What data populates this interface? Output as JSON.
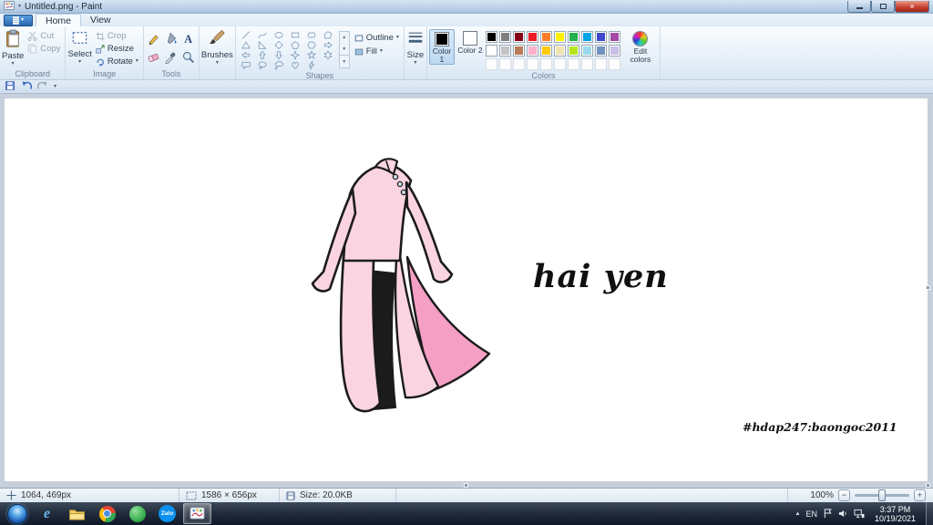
{
  "window": {
    "title": "Untitled.png - Paint"
  },
  "tabs": {
    "home": "Home",
    "view": "View"
  },
  "ribbon": {
    "clipboard": {
      "group_label": "Clipboard",
      "paste_label": "Paste",
      "cut_label": "Cut",
      "copy_label": "Copy"
    },
    "image": {
      "group_label": "Image",
      "select_label": "Select",
      "crop_label": "Crop",
      "resize_label": "Resize",
      "rotate_label": "Rotate"
    },
    "tools": {
      "group_label": "Tools",
      "items": [
        "pencil",
        "fill-with-color",
        "text",
        "eraser",
        "color-picker",
        "magnifier"
      ]
    },
    "brushes": {
      "label": "Brushes"
    },
    "shapes": {
      "group_label": "Shapes",
      "outline_label": "Outline",
      "fill_label": "Fill",
      "items": [
        "line",
        "curve",
        "oval",
        "rectangle",
        "rounded-rectangle",
        "polygon",
        "triangle",
        "right-triangle",
        "diamond",
        "pentagon",
        "hexagon",
        "right-arrow",
        "left-arrow",
        "up-arrow",
        "down-arrow",
        "four-point-star",
        "five-point-star",
        "six-point-star",
        "rounded-callout",
        "oval-callout",
        "cloud-callout",
        "heart",
        "lightning"
      ]
    },
    "size": {
      "label": "Size"
    },
    "colors": {
      "group_label": "Colors",
      "color1_label": "Color 1",
      "color2_label": "Color 2",
      "edit_label": "Edit colors",
      "color1": "#000000",
      "color2": "#ffffff",
      "row1": [
        "#000000",
        "#7f7f7f",
        "#880015",
        "#ed1c24",
        "#ff7f27",
        "#fff200",
        "#22b14c",
        "#00a2e8",
        "#3f48cc",
        "#a349a4"
      ],
      "row2": [
        "#ffffff",
        "#c3c3c3",
        "#b97a57",
        "#ffaec9",
        "#ffc90e",
        "#efe4b0",
        "#b5e61d",
        "#99d9ea",
        "#7092be",
        "#c8bfe7"
      ],
      "empty_slots": 10
    }
  },
  "canvas": {
    "main_text": "hai yen",
    "watermark_text": "#hdap247:baongoc2011",
    "dress": {
      "outline": "#1b1b1b",
      "body": "#fbd4e1",
      "lining": "#f59fc5",
      "pants": "#1b1b1b",
      "buttons": "#cfe0ee"
    }
  },
  "statusbar": {
    "cursor_position": "1064, 469px",
    "image_size": "1586 × 656px",
    "file_size": "Size: 20.0KB",
    "zoom": "100%"
  },
  "taskbar": {
    "zalo_label": "Zalo",
    "tray": {
      "language": "EN",
      "time": "3:37 PM",
      "date": "10/19/2021"
    }
  }
}
